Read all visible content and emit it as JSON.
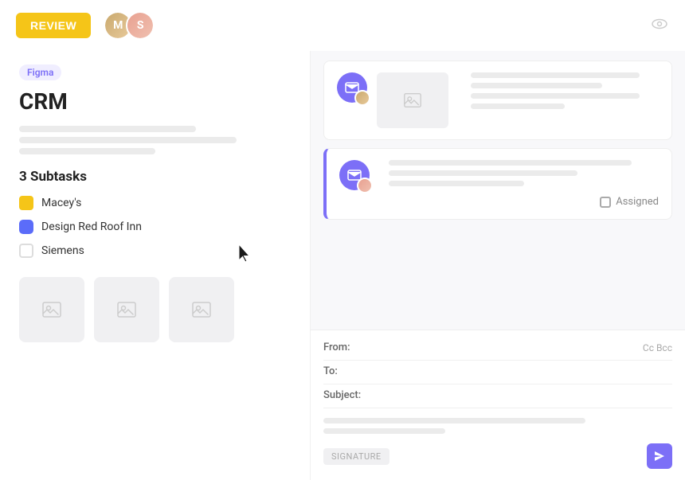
{
  "topbar": {
    "review_label": "REVIEW",
    "avatar1_initials": "M",
    "avatar2_initials": "S"
  },
  "left": {
    "badge_label": "Figma",
    "project_title": "CRM",
    "subtasks_heading": "3 Subtasks",
    "subtasks": [
      {
        "label": "Macey's",
        "state": "yellow"
      },
      {
        "label": "Design Red Roof Inn",
        "state": "blue"
      },
      {
        "label": "Siemens",
        "state": "empty"
      }
    ]
  },
  "right": {
    "email1": {
      "assigned_label": "Assigned"
    },
    "compose": {
      "from_label": "From:",
      "to_label": "To:",
      "subject_label": "Subject:",
      "cc_label": "Cc Bcc",
      "signature_label": "SIGNATURE"
    }
  }
}
